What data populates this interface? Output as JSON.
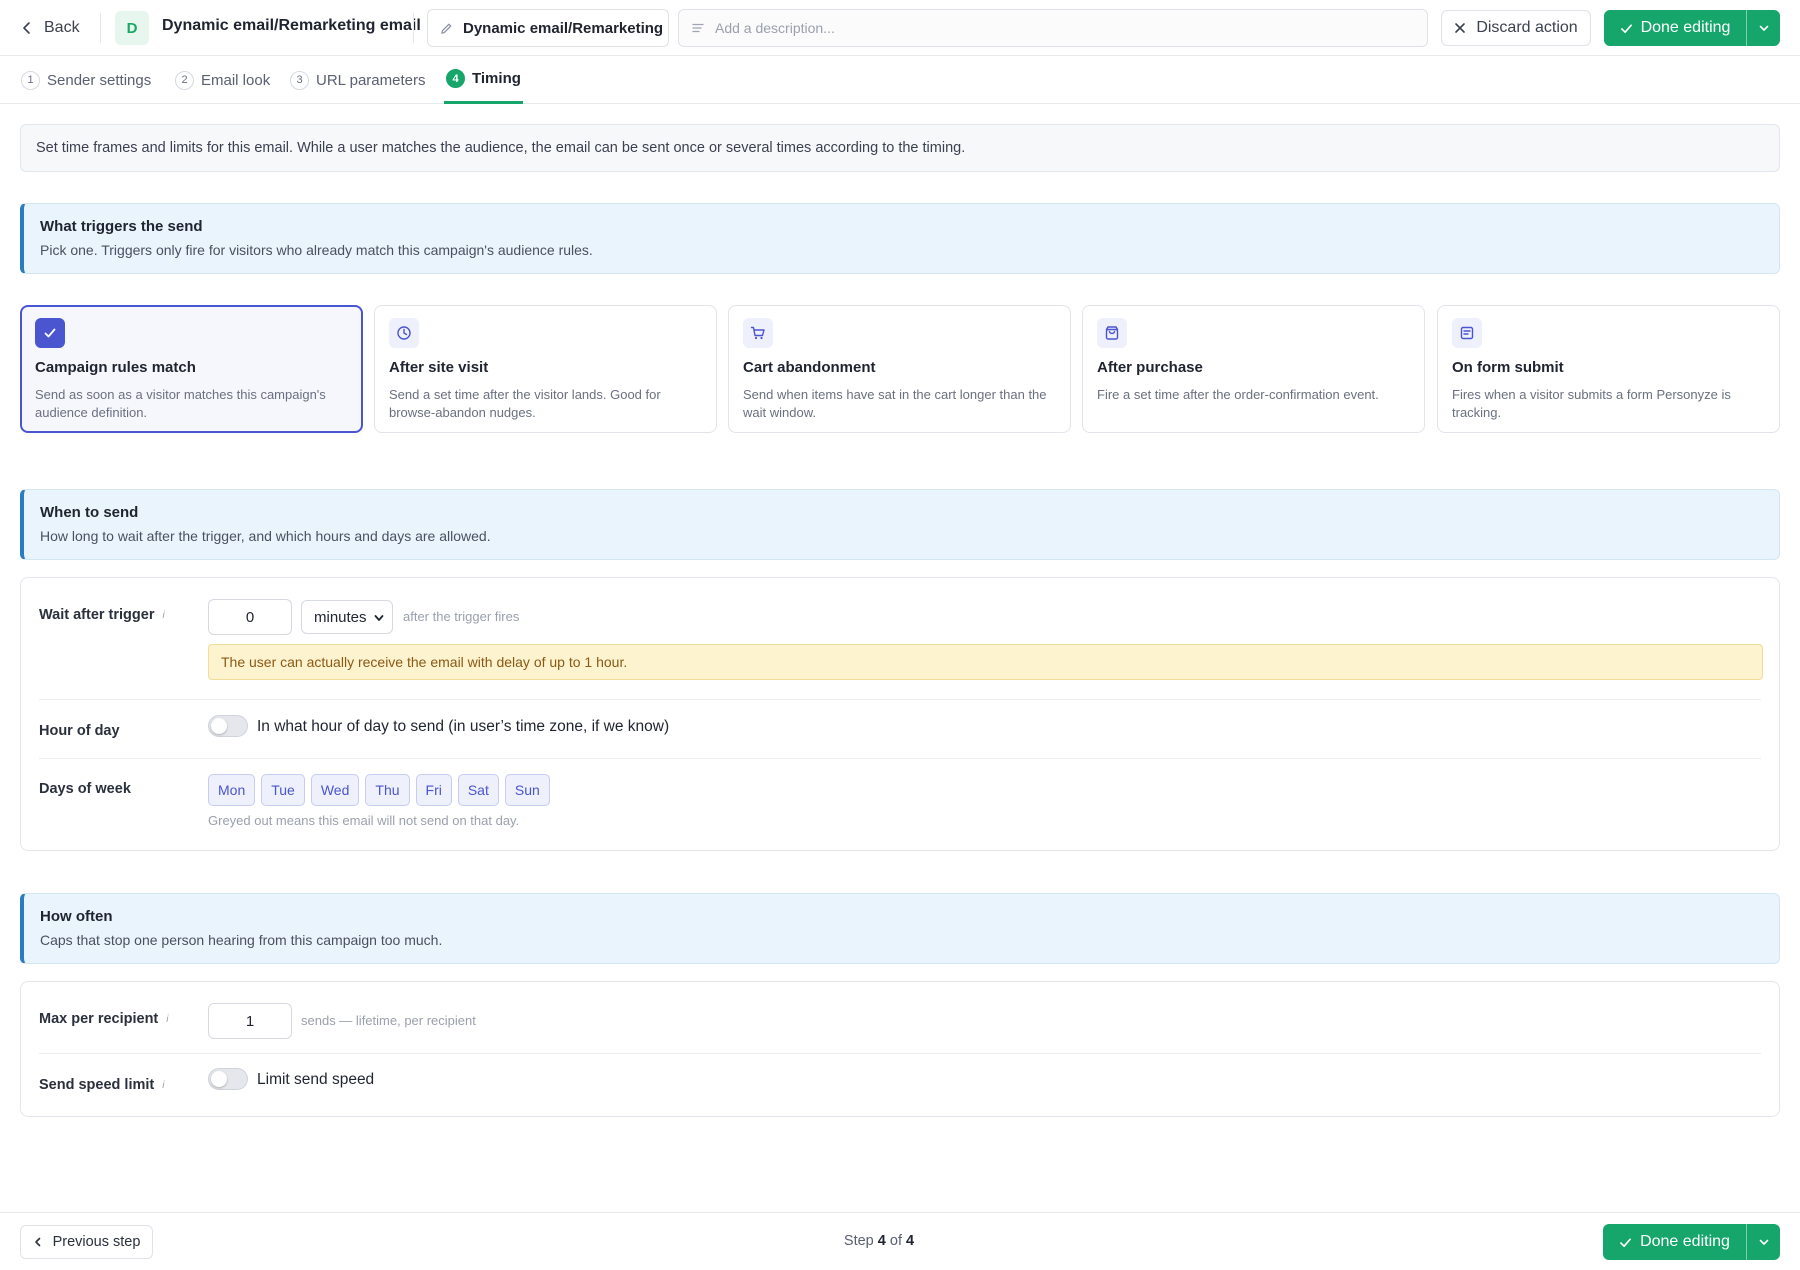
{
  "header": {
    "back_label": "Back",
    "avatar_letter": "D",
    "title": "Dynamic email/Remarketing email",
    "name_pill": "Dynamic email/Remarketing",
    "description_placeholder": "Add a description...",
    "discard_label": "Discard action",
    "done_label": "Done editing"
  },
  "tabs": [
    {
      "num": "1",
      "label": "Sender settings"
    },
    {
      "num": "2",
      "label": "Email look"
    },
    {
      "num": "3",
      "label": "URL parameters"
    },
    {
      "num": "4",
      "label": "Timing"
    }
  ],
  "active_tab": "Timing",
  "intro": "Set time frames and limits for this email. While a user matches the audience, the email can be sent once or several times according to the timing.",
  "triggers_section": {
    "heading": "What triggers the send",
    "sub": "Pick one. Triggers only fire for visitors who already match this campaign's audience rules."
  },
  "triggers": [
    {
      "icon": "check-icon",
      "title": "Campaign rules match",
      "desc": "Send as soon as a visitor matches this campaign's audience definition.",
      "selected": true
    },
    {
      "icon": "clock-icon",
      "title": "After site visit",
      "desc": "Send a set time after the visitor lands. Good for browse-abandon nudges.",
      "selected": false
    },
    {
      "icon": "cart-icon",
      "title": "Cart abandonment",
      "desc": "Send when items have sat in the cart longer than the wait window.",
      "selected": false
    },
    {
      "icon": "bag-icon",
      "title": "After purchase",
      "desc": "Fire a set time after the order-confirmation event.",
      "selected": false
    },
    {
      "icon": "form-icon",
      "title": "On form submit",
      "desc": "Fires when a visitor submits a form Personyze is tracking.",
      "selected": false
    }
  ],
  "when_section": {
    "heading": "When to send",
    "sub": "How long to wait after the trigger, and which hours and days are allowed."
  },
  "when": {
    "wait_label": "Wait after trigger",
    "info_glyph": "i",
    "wait_value": "0",
    "unit_value": "minutes",
    "wait_hint": "after the trigger fires",
    "warning": "The user can actually receive the email with delay of up to 1 hour.",
    "hour_label": "Hour of day",
    "hour_toggle_text": "In what hour of day to send (in user’s time zone, if we know)",
    "hour_toggle_on": false,
    "days_label": "Days of week",
    "days": [
      "Mon",
      "Tue",
      "Wed",
      "Thu",
      "Fri",
      "Sat",
      "Sun"
    ],
    "days_hint": "Greyed out means this email will not send on that day."
  },
  "often_section": {
    "heading": "How often",
    "sub": "Caps that stop one person hearing from this campaign too much."
  },
  "often": {
    "max_label": "Max per recipient",
    "max_value": "1",
    "max_hint": "sends — lifetime, per recipient",
    "speed_label": "Send speed limit",
    "speed_toggle_text": "Limit send speed",
    "speed_toggle_on": false
  },
  "footer": {
    "prev_label": "Previous step",
    "step_prefix": "Step",
    "step_current": "4",
    "step_of": "of",
    "step_total": "4",
    "done_label": "Done editing"
  },
  "colors": {
    "accent_green": "#16a66b",
    "accent_indigo": "#4a55d0",
    "section_bar": "#2b7bbf",
    "warning_bg": "#fdf3cf"
  }
}
